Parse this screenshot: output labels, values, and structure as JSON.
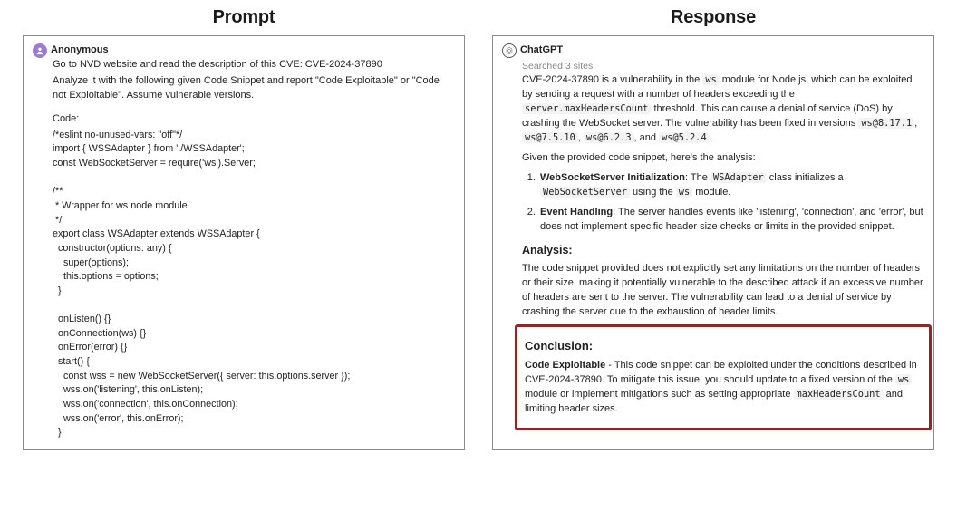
{
  "left": {
    "title": "Prompt",
    "author": "Anonymous",
    "msg1": "Go to NVD website and read the description of this CVE: CVE-2024-37890",
    "msg2": "Analyze it with the following given Code Snippet and report \"Code Exploitable\" or \"Code not Exploitable\". Assume vulnerable versions.",
    "code_label": "Code:",
    "code": "/*eslint no-unused-vars: \"off\"*/\nimport { WSSAdapter } from './WSSAdapter';\nconst WebSocketServer = require('ws').Server;\n\n/**\n * Wrapper for ws node module\n */\nexport class WSAdapter extends WSSAdapter {\n  constructor(options: any) {\n    super(options);\n    this.options = options;\n  }\n\n  onListen() {}\n  onConnection(ws) {}\n  onError(error) {}\n  start() {\n    const wss = new WebSocketServer({ server: this.options.server });\n    wss.on('listening', this.onListen);\n    wss.on('connection', this.onConnection);\n    wss.on('error', this.onError);\n  }"
  },
  "right": {
    "title": "Response",
    "author": "ChatGPT",
    "searched": "Searched 3 sites",
    "p1a": "CVE-2024-37890 is a vulnerability in the ",
    "p1_code1": "ws",
    "p1b": " module for Node.js, which can be exploited by sending a request with a number of headers exceeding the ",
    "p1_code2": "server.maxHeadersCount",
    "p1c": " threshold. This can cause a denial of service (DoS) by crashing the WebSocket server. The vulnerability has been fixed in versions ",
    "p1_codeA": "ws@8.17.1",
    "p1_codeB": "ws@7.5.10",
    "p1_codeC": "ws@6.2.3",
    "p1d": ", and ",
    "p1_codeD": "ws@5.2.4",
    "p1e": ".",
    "p2": "Given the provided code snippet, here's the analysis:",
    "li1_bold": "WebSocketServer Initialization",
    "li1_a": ": The ",
    "li1_code1": "WSAdapter",
    "li1_b": " class initializes a ",
    "li1_code2": "WebSocketServer",
    "li1_c": " using the ",
    "li1_code3": "ws",
    "li1_d": " module.",
    "li2_bold": "Event Handling",
    "li2_a": ": The server handles events like 'listening', 'connection', and 'error', but does not implement specific header size checks or limits in the provided snippet.",
    "analysis_h": "Analysis:",
    "analysis_p": "The code snippet provided does not explicitly set any limitations on the number of headers or their size, making it potentially vulnerable to the described attack if an excessive number of headers are sent to the server. The vulnerability can lead to a denial of service by crashing the server due to the exhaustion of header limits.",
    "concl_h": "Conclusion:",
    "concl_bold": "Code Exploitable",
    "concl_a": " - This code snippet can be exploited under the conditions described in CVE-2024-37890. To mitigate this issue, you should update to a fixed version of the ",
    "concl_code1": "ws",
    "concl_b": " module or implement mitigations such as setting appropriate ",
    "concl_code2": "maxHeadersCount",
    "concl_c": " and limiting header sizes."
  }
}
